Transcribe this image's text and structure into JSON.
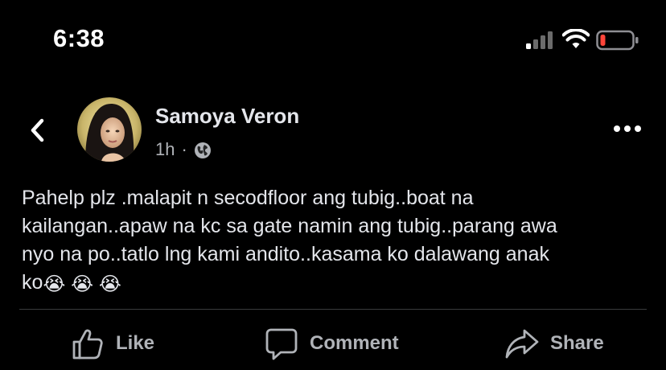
{
  "status_bar": {
    "time": "6:38",
    "icons": [
      "signal-icon",
      "wifi-icon",
      "battery-icon"
    ],
    "battery_color": "#ff453a"
  },
  "post": {
    "author": "Samoya Veron",
    "time_ago": "1h",
    "separator": "·",
    "privacy_icon": "globe-icon",
    "body_lines": [
      "Pahelp plz .malapit n secodfloor ang tubig..boat na",
      "kailangan..apaw na kc sa gate namin ang tubig..parang awa",
      "nyo na po..tatlo lng kami andito..kasama ko dalawang anak",
      "ko"
    ],
    "emojis": "😭 😭 😭"
  },
  "actions": {
    "like_label": "Like",
    "comment_label": "Comment",
    "share_label": "Share"
  },
  "colors": {
    "background": "#000000",
    "text_primary": "#e4e6eb",
    "text_secondary": "#b0b3b8",
    "divider": "#3a3b3c"
  }
}
